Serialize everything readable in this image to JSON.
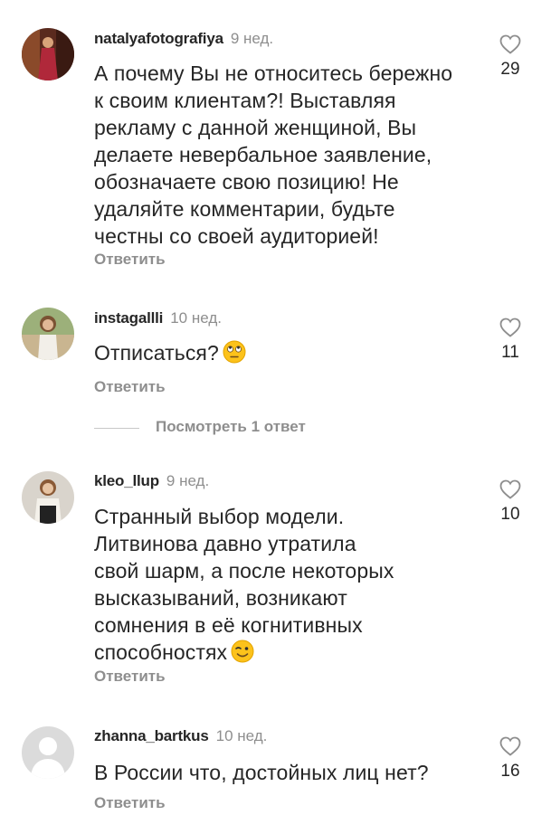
{
  "comments": [
    {
      "username": "natalyafotografiya",
      "time": "9 нед.",
      "lines": [
        "А почему Вы не относитесь бережно",
        "к своим клиентам?! Выставляя",
        "рекламу с данной женщиной, Вы",
        "делаете невербальное заявление,",
        "обозначаете свою позицию! Не",
        "удаляйте комментарии, будьте",
        "честны со своей аудиторией!"
      ],
      "likes": "29",
      "reply_label": "Ответить"
    },
    {
      "username": "instagallli",
      "time": "10 нед.",
      "lines": [
        "Отписаться?"
      ],
      "emoji": "face-with-rolling-eyes",
      "likes": "11",
      "reply_label": "Ответить"
    },
    {
      "username": "kleo_llup",
      "time": "9 нед.",
      "lines": [
        "Странный выбор модели.",
        "Литвинова давно утратила",
        "свой шарм, а после некоторых",
        "высказываний, возникают",
        "сомнения в её когнитивных",
        "способностях"
      ],
      "emoji": "winking-face",
      "likes": "10",
      "reply_label": "Ответить"
    },
    {
      "username": "zhanna_bartkus",
      "time": "10 нед.",
      "lines": [
        "В России что, достойных лиц нет?"
      ],
      "likes": "16",
      "reply_label": "Ответить"
    }
  ],
  "view_replies_label": "Посмотреть 1 ответ",
  "colors": {
    "text": "#262626",
    "secondary": "#8e8e8e",
    "background": "#ffffff"
  }
}
